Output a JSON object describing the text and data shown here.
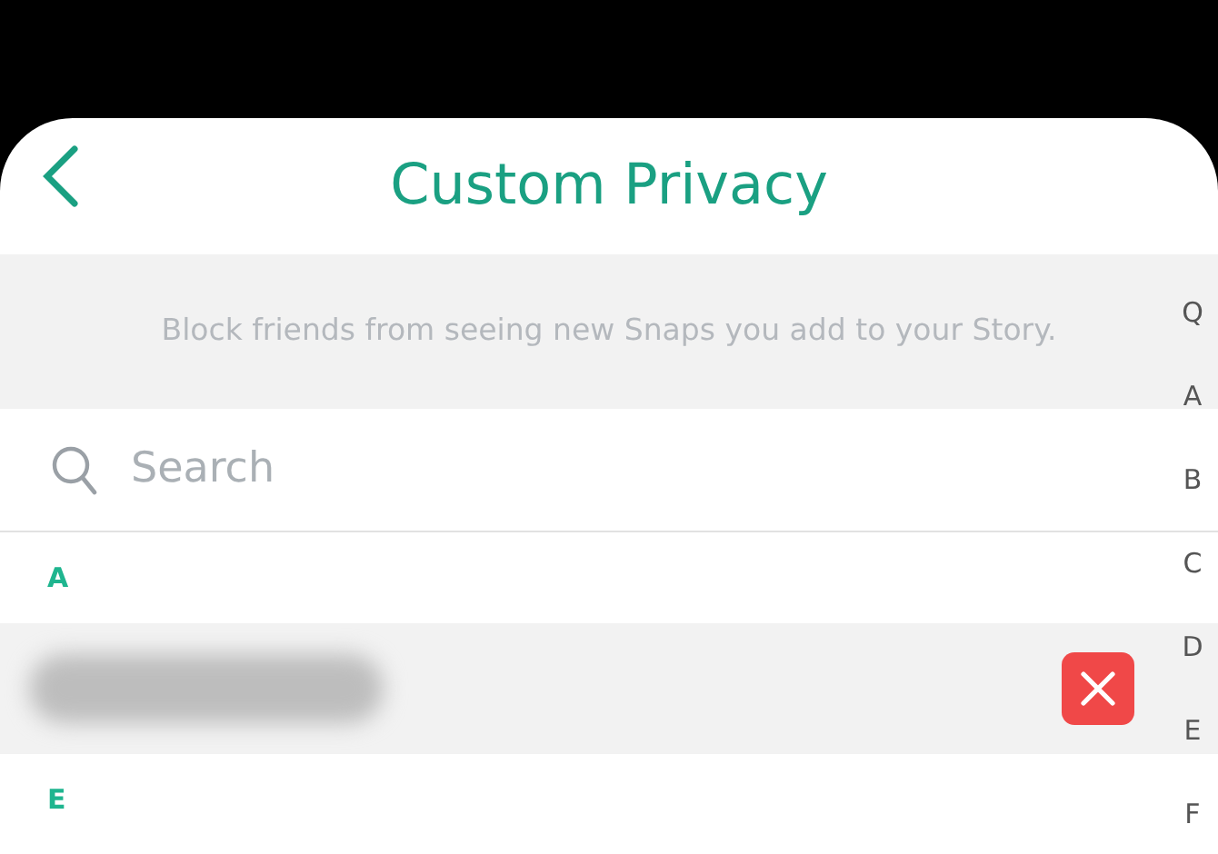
{
  "header": {
    "title": "Custom Privacy"
  },
  "banner": "Block friends from seeing new Snaps you add to your Story.",
  "search": {
    "placeholder": "Search"
  },
  "sections": [
    {
      "letter": "A",
      "friends": [
        {
          "blocked": true
        }
      ]
    },
    {
      "letter": "E"
    }
  ],
  "index": [
    "Q",
    "A",
    "B",
    "C",
    "D",
    "E",
    "F"
  ]
}
